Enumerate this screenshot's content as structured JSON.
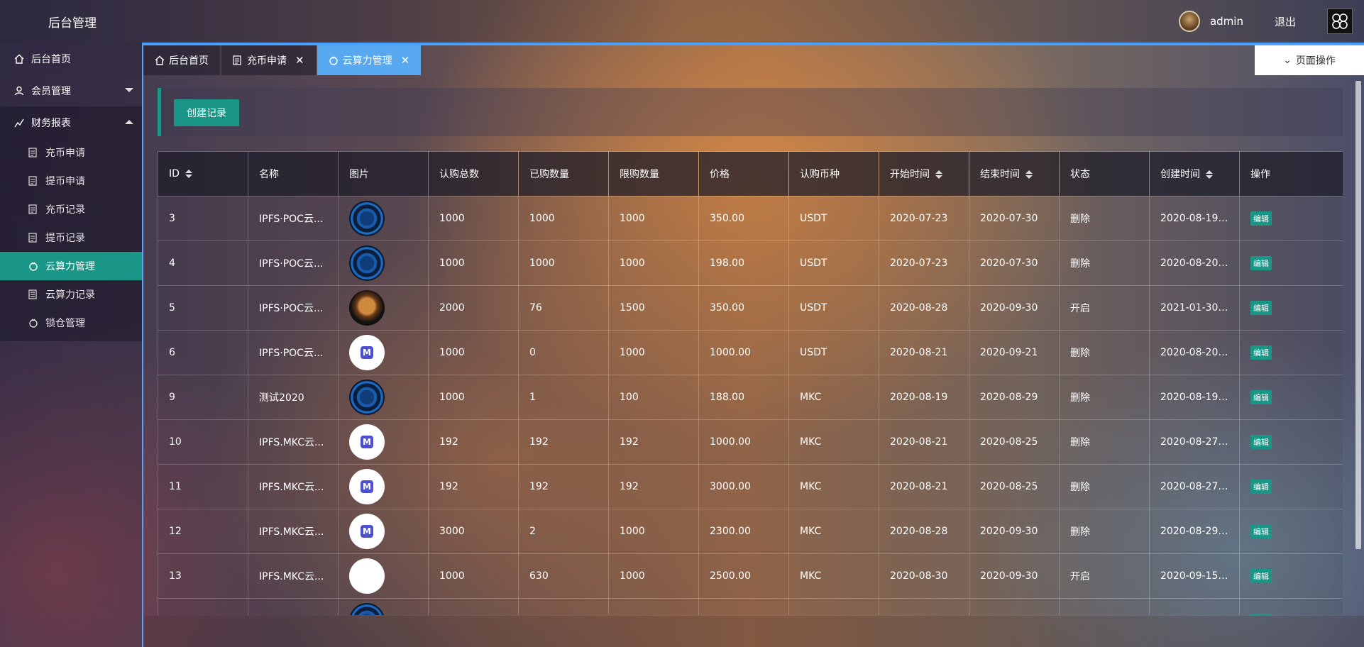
{
  "header": {
    "brand": "后台管理",
    "username": "admin",
    "logout": "退出"
  },
  "sidebar": {
    "items": [
      {
        "label": "后台首页",
        "icon": "home-icon"
      },
      {
        "label": "会员管理",
        "icon": "user-icon"
      },
      {
        "label": "财务报表",
        "icon": "chart-icon"
      }
    ],
    "sub_items": [
      {
        "label": "充币申请",
        "icon": "document-icon"
      },
      {
        "label": "提币申请",
        "icon": "document-icon"
      },
      {
        "label": "充币记录",
        "icon": "document-icon"
      },
      {
        "label": "提币记录",
        "icon": "document-icon"
      },
      {
        "label": "云算力管理",
        "icon": "cloud-icon"
      },
      {
        "label": "云算力记录",
        "icon": "record-icon"
      },
      {
        "label": "锁仓管理",
        "icon": "lock-icon"
      }
    ],
    "active_sub": "云算力管理"
  },
  "tabs": [
    {
      "label": "后台首页",
      "closable": false
    },
    {
      "label": "充币申请",
      "closable": true
    },
    {
      "label": "云算力管理",
      "closable": true
    }
  ],
  "page_ops": "页面操作",
  "toolbar": {
    "create_label": "创建记录"
  },
  "table": {
    "headers": [
      "ID",
      "名称",
      "图片",
      "认购总数",
      "已购数量",
      "限购数量",
      "价格",
      "认购币种",
      "开始时间",
      "结束时间",
      "状态",
      "创建时间",
      "操作"
    ],
    "edit_label": "编辑",
    "rows": [
      [
        "3",
        "IPFS·POC云...",
        "coin",
        "1000",
        "1000",
        "1000",
        "350.00",
        "USDT",
        "2020-07-23",
        "2020-07-30",
        "删除",
        "2020-08-19 ..."
      ],
      [
        "4",
        "IPFS·POC云...",
        "coin",
        "1000",
        "1000",
        "1000",
        "198.00",
        "USDT",
        "2020-07-23",
        "2020-07-30",
        "删除",
        "2020-08-20 ..."
      ],
      [
        "5",
        "IPFS·POC云...",
        "bull",
        "2000",
        "76",
        "1500",
        "350.00",
        "USDT",
        "2020-08-28",
        "2020-09-30",
        "开启",
        "2021-01-30 ..."
      ],
      [
        "6",
        "IPFS·POC云...",
        "mlogo",
        "1000",
        "0",
        "1000",
        "1000.00",
        "USDT",
        "2020-08-21",
        "2020-09-21",
        "删除",
        "2020-08-20 ..."
      ],
      [
        "9",
        "测试2020",
        "coin",
        "1000",
        "1",
        "100",
        "188.00",
        "MKC",
        "2020-08-19",
        "2020-08-29",
        "删除",
        "2020-08-19 ..."
      ],
      [
        "10",
        "IPFS.MKC云...",
        "mlogo",
        "192",
        "192",
        "192",
        "1000.00",
        "MKC",
        "2020-08-21",
        "2020-08-25",
        "删除",
        "2020-08-27 ..."
      ],
      [
        "11",
        "IPFS.MKC云...",
        "mlogo",
        "192",
        "192",
        "192",
        "3000.00",
        "MKC",
        "2020-08-21",
        "2020-08-25",
        "删除",
        "2020-08-27 ..."
      ],
      [
        "12",
        "IPFS.MKC云...",
        "mlogo",
        "3000",
        "2",
        "1000",
        "2300.00",
        "MKC",
        "2020-08-28",
        "2020-09-30",
        "删除",
        "2020-08-29 ..."
      ],
      [
        "13",
        "IPFS.MKC云...",
        "text",
        "1000",
        "630",
        "1000",
        "2500.00",
        "MKC",
        "2020-08-30",
        "2020-09-30",
        "开启",
        "2020-09-15 ..."
      ],
      [
        "",
        "",
        "coin",
        "",
        "",
        "",
        "",
        "",
        "",
        "",
        "",
        ""
      ]
    ]
  }
}
